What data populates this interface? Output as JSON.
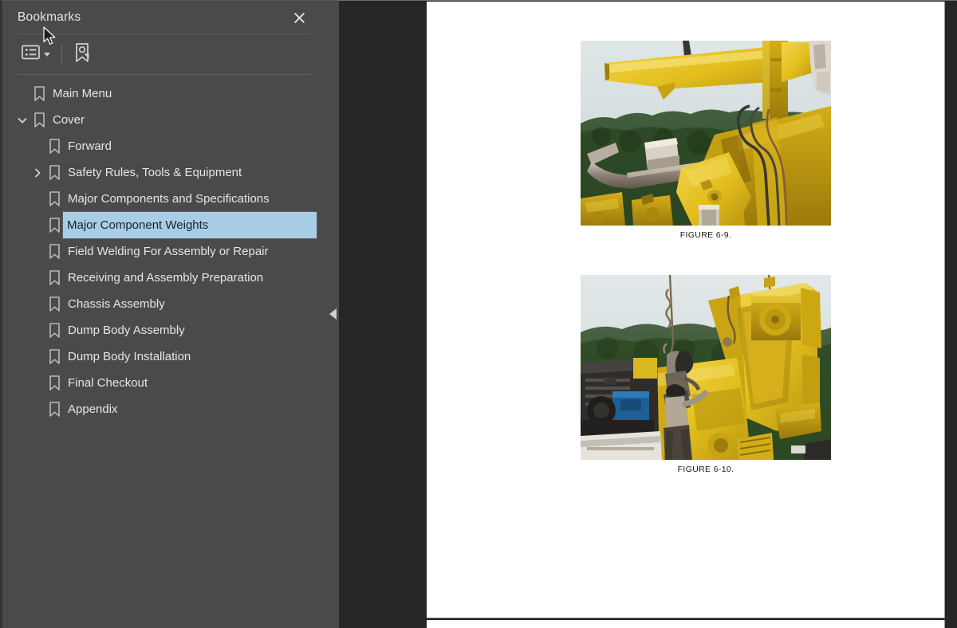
{
  "panel": {
    "title": "Bookmarks",
    "close_label": "✕",
    "close_icon": "close-icon",
    "toolbar": {
      "options_icon": "list-options-icon",
      "options_label": "Options",
      "dropdown_icon": "chevron-down-icon",
      "new_bookmark_icon": "new-bookmark-icon",
      "new_bookmark_label": "New Bookmark"
    },
    "collapse_handle_icon": "triangle-left-icon",
    "collapse_handle_label": "Collapse panel"
  },
  "bookmarks": [
    {
      "label": "Main Menu",
      "depth": 0,
      "twisty": "none",
      "selected": false,
      "icon": "bookmark-icon"
    },
    {
      "label": "Cover",
      "depth": 0,
      "twisty": "expanded",
      "selected": false,
      "icon": "bookmark-icon"
    },
    {
      "label": "Forward",
      "depth": 1,
      "twisty": "none",
      "selected": false,
      "icon": "bookmark-icon"
    },
    {
      "label": "Safety Rules, Tools & Equipment",
      "depth": 1,
      "twisty": "collapsed",
      "selected": false,
      "icon": "bookmark-icon"
    },
    {
      "label": "Major Components and Specifications",
      "depth": 1,
      "twisty": "none",
      "selected": false,
      "icon": "bookmark-icon"
    },
    {
      "label": "Major Component Weights",
      "depth": 1,
      "twisty": "none",
      "selected": true,
      "icon": "bookmark-icon"
    },
    {
      "label": "Field Welding For Assembly or Repair",
      "depth": 1,
      "twisty": "none",
      "selected": false,
      "icon": "bookmark-icon"
    },
    {
      "label": "Receiving and Assembly Preparation",
      "depth": 1,
      "twisty": "none",
      "selected": false,
      "icon": "bookmark-icon"
    },
    {
      "label": "Chassis Assembly",
      "depth": 1,
      "twisty": "none",
      "selected": false,
      "icon": "bookmark-icon"
    },
    {
      "label": "Dump Body Assembly",
      "depth": 1,
      "twisty": "none",
      "selected": false,
      "icon": "bookmark-icon"
    },
    {
      "label": "Dump Body Installation",
      "depth": 1,
      "twisty": "none",
      "selected": false,
      "icon": "bookmark-icon"
    },
    {
      "label": "Final Checkout",
      "depth": 1,
      "twisty": "none",
      "selected": false,
      "icon": "bookmark-icon"
    },
    {
      "label": "Appendix",
      "depth": 1,
      "twisty": "none",
      "selected": false,
      "icon": "bookmark-icon"
    }
  ],
  "document": {
    "figures": [
      {
        "caption": "FIGURE 6-9.",
        "description": "Yellow dump body top rail section suspended by sling above machinery"
      },
      {
        "caption": "FIGURE 6-10.",
        "description": "Two workers guiding a yellow dump body section lifted by crane"
      }
    ]
  },
  "colors": {
    "panel_bg": "#4a4a4a",
    "viewer_bg": "#262626",
    "page_bg": "#ffffff",
    "selection_bg": "#a9cde4",
    "text": "#e6e6e6",
    "machine_yellow": "#e8c420"
  }
}
